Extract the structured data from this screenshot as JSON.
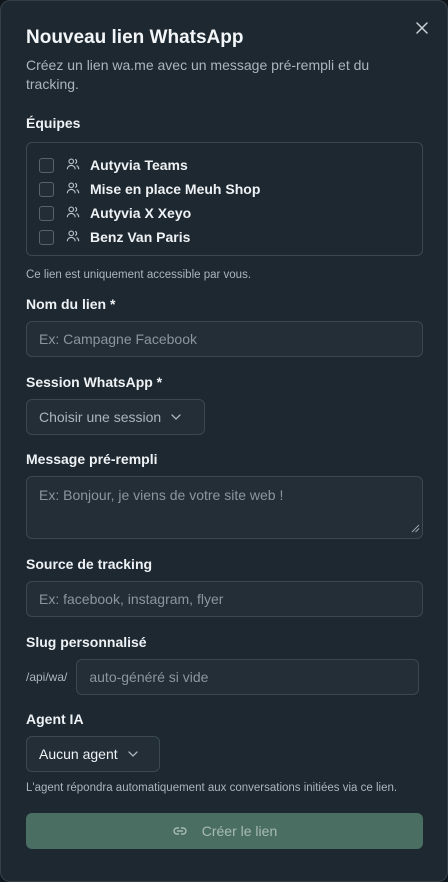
{
  "dialog": {
    "title": "Nouveau lien WhatsApp",
    "subtitle": "Créez un lien wa.me avec un message pré-rempli et du tracking."
  },
  "teams": {
    "label": "Équipes",
    "items": [
      {
        "name": "Autyvia Teams",
        "checked": false
      },
      {
        "name": "Mise en place Meuh Shop",
        "checked": false
      },
      {
        "name": "Autyvia X Xeyo",
        "checked": false
      },
      {
        "name": "Benz Van Paris",
        "checked": false
      }
    ],
    "hint": "Ce lien est uniquement accessible par vous."
  },
  "link_name": {
    "label": "Nom du lien *",
    "placeholder": "Ex: Campagne Facebook",
    "value": ""
  },
  "session": {
    "label": "Session WhatsApp *",
    "selected": "Choisir une session"
  },
  "message": {
    "label": "Message pré-rempli",
    "placeholder": "Ex: Bonjour, je viens de votre site web !",
    "value": ""
  },
  "tracking": {
    "label": "Source de tracking",
    "placeholder": "Ex: facebook, instagram, flyer",
    "value": ""
  },
  "slug": {
    "label": "Slug personnalisé",
    "prefix": "/api/wa/",
    "placeholder": "auto-généré si vide",
    "value": ""
  },
  "agent": {
    "label": "Agent IA",
    "selected": "Aucun agent",
    "hint": "L'agent répondra automatiquement aux conversations initiées via ce lien."
  },
  "submit": {
    "label": "Créer le lien",
    "icon": "link-icon"
  },
  "colors": {
    "panel": "#1e2830",
    "border": "#3a4852",
    "submit": "#4a6e62"
  }
}
